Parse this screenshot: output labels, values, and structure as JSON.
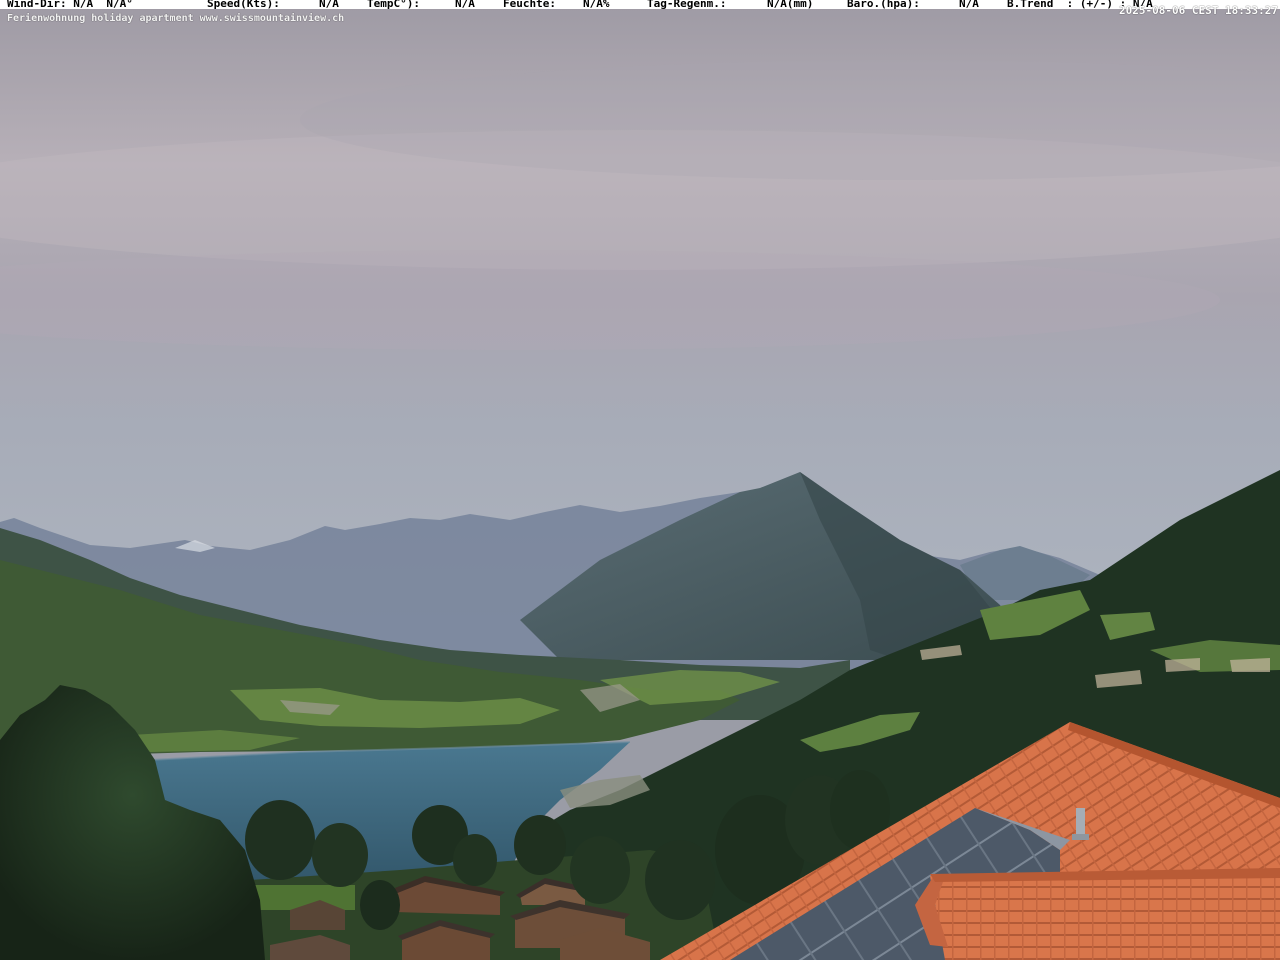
{
  "overlay": {
    "weather": [
      "Wind-Dir: N/A  N/A°",
      "Speed(Kts):",
      "N/A",
      "TempC°):",
      "N/A",
      "Feuchte:",
      "N/A%",
      "Tag-Regenm.:",
      "N/A(mm)",
      "Baro.(hpa):",
      "N/A",
      "B.Trend  : (+/-) : N/A"
    ],
    "timestamp": "2025-08-06 CEST 18:33:27",
    "caption": "Ferienwohnung holiday apartment www.swissmountainview.ch"
  },
  "colors": {
    "sky_top": "#9e9aa4",
    "sky_mid": "#b9b3bb",
    "sky_horizon": "#a7acb8",
    "distant_mountains": "#6f7c8e",
    "peak": "#485a60",
    "lake": "#3e6a82",
    "forest_dark": "#243625",
    "meadow": "#5f8240",
    "roof_tiles": "#d8744a",
    "solar_panels": "#4a5564"
  },
  "scene_labels": {
    "scene": "webcam-view"
  }
}
